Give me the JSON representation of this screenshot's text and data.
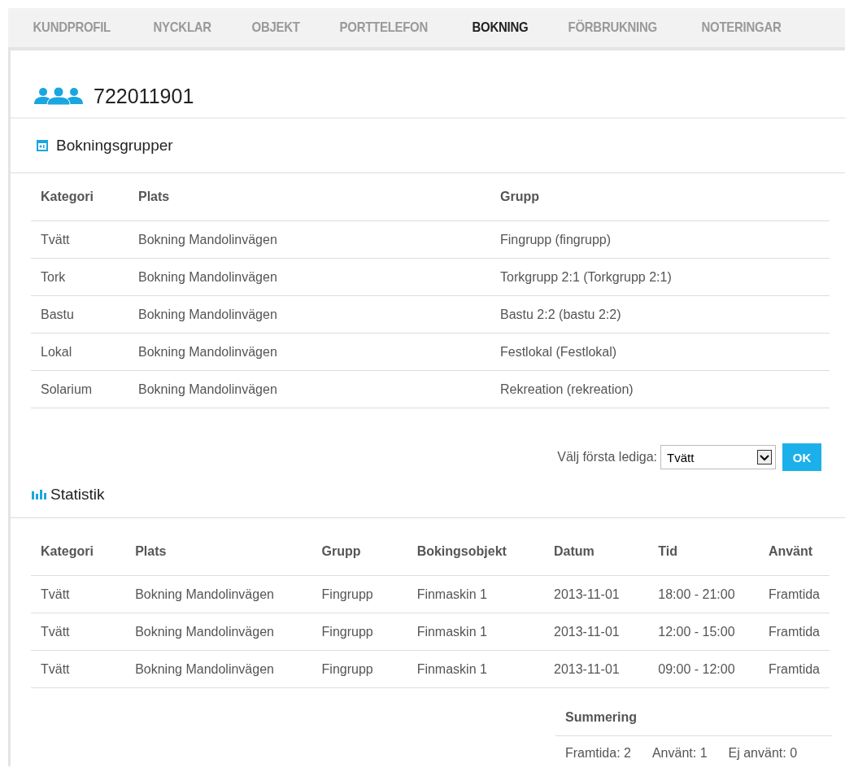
{
  "tabs": [
    {
      "label": "KUNDPROFIL",
      "selected": false
    },
    {
      "label": "NYCKLAR",
      "selected": false
    },
    {
      "label": "OBJEKT",
      "selected": false
    },
    {
      "label": "PORTTELEFON",
      "selected": false
    },
    {
      "label": "BOKNING",
      "selected": true
    },
    {
      "label": "FÖRBRUKNING",
      "selected": false
    },
    {
      "label": "NOTERINGAR",
      "selected": false
    }
  ],
  "title": "722011901",
  "booking_groups": {
    "heading": "Bokningsgrupper",
    "columns": [
      "Kategori",
      "Plats",
      "Grupp"
    ],
    "rows": [
      [
        "Tvätt",
        "Bokning Mandolinvägen",
        "Fingrupp (fingrupp)"
      ],
      [
        "Tork",
        "Bokning Mandolinvägen",
        "Torkgrupp 2:1 (Torkgrupp 2:1)"
      ],
      [
        "Bastu",
        "Bokning Mandolinvägen",
        "Bastu 2:2 (bastu 2:2)"
      ],
      [
        "Lokal",
        "Bokning Mandolinvägen",
        "Festlokal (Festlokal)"
      ],
      [
        "Solarium",
        "Bokning Mandolinvägen",
        "Rekreation (rekreation)"
      ]
    ]
  },
  "first_free": {
    "label": "Välj första lediga:",
    "value": "Tvätt",
    "button": "OK"
  },
  "statistics": {
    "heading": "Statistik",
    "columns": [
      "Kategori",
      "Plats",
      "Grupp",
      "Bokingsobjekt",
      "Datum",
      "Tid",
      "Använt"
    ],
    "rows": [
      [
        "Tvätt",
        "Bokning Mandolinvägen",
        "Fingrupp",
        "Finmaskin 1",
        "2013-11-01",
        "18:00 - 21:00",
        "Framtida"
      ],
      [
        "Tvätt",
        "Bokning Mandolinvägen",
        "Fingrupp",
        "Finmaskin 1",
        "2013-11-01",
        "12:00 - 15:00",
        "Framtida"
      ],
      [
        "Tvätt",
        "Bokning Mandolinvägen",
        "Fingrupp",
        "Finmaskin 1",
        "2013-11-01",
        "09:00 - 12:00",
        "Framtida"
      ]
    ]
  },
  "summary": {
    "heading": "Summering",
    "items": [
      "Framtida: 2",
      "Använt: 1",
      "Ej använt: 0"
    ]
  }
}
